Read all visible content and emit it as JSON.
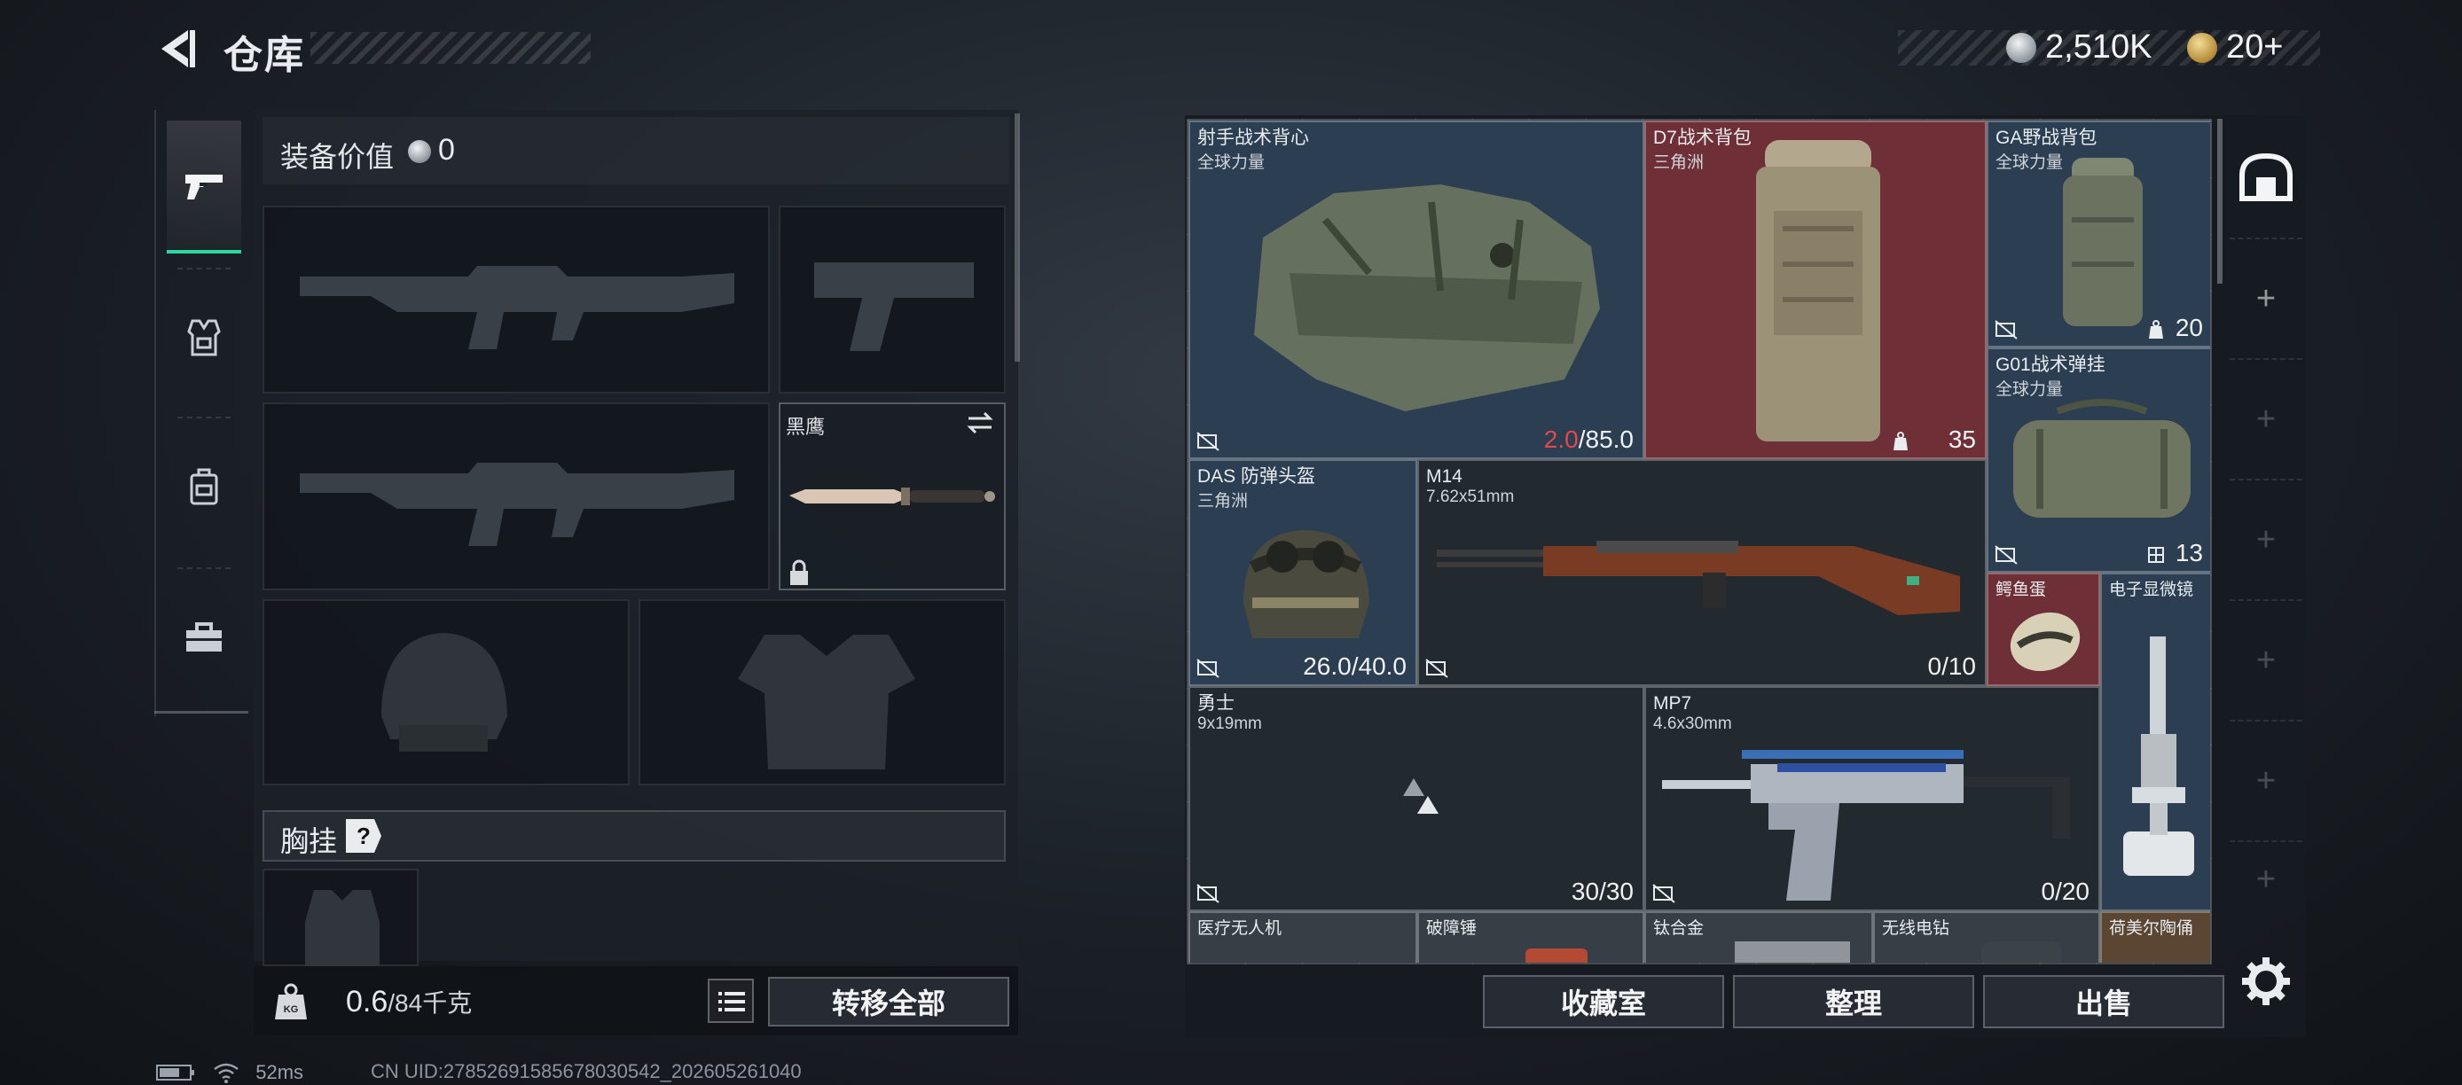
{
  "header": {
    "title": "仓库",
    "currency_main": "2,510K",
    "currency_secondary": "20+"
  },
  "side_tabs": [
    {
      "name": "weapons-tab",
      "icon": "pistol-icon",
      "active": true
    },
    {
      "name": "armor-tab",
      "icon": "armor-vest-icon",
      "active": false
    },
    {
      "name": "backpack-tab",
      "icon": "backpack-icon",
      "active": false
    },
    {
      "name": "toolbox-tab",
      "icon": "toolbox-icon",
      "active": false
    }
  ],
  "equipment": {
    "value_label": "装备价值",
    "value": "0",
    "knife_name": "黑鹰",
    "chest_rig_label": "胸挂",
    "help": "?",
    "weight_value": "0.6",
    "weight_capacity": "/84千克",
    "transfer_all": "转移全部"
  },
  "stash": {
    "items": [
      {
        "name": "射手战术背心",
        "sub": "全球力量",
        "value_hl": "2.0",
        "value": "/85.0"
      },
      {
        "name": "D7战术背包",
        "sub": "三角洲",
        "value": "35"
      },
      {
        "name": "GA野战背包",
        "sub": "全球力量",
        "value": "20"
      },
      {
        "name": "G01战术弹挂",
        "sub": "全球力量",
        "value": "13"
      },
      {
        "name": "DAS 防弹头盔",
        "sub": "三角洲",
        "value": "26.0/40.0"
      },
      {
        "name": "M14",
        "sub": "7.62x51mm",
        "value": "0/10"
      },
      {
        "name": "鳄鱼蛋",
        "sub": "",
        "value": ""
      },
      {
        "name": "电子显微镜",
        "sub": "",
        "value": ""
      },
      {
        "name": "勇士",
        "sub": "9x19mm",
        "value": "30/30"
      },
      {
        "name": "MP7",
        "sub": "4.6x30mm",
        "value": "0/20"
      },
      {
        "name": "医疗无人机",
        "sub": "",
        "value": ""
      },
      {
        "name": "破障锤",
        "sub": "",
        "value": ""
      },
      {
        "name": "钛合金",
        "sub": "",
        "value": ""
      },
      {
        "name": "无线电钻",
        "sub": "",
        "value": ""
      },
      {
        "name": "荷美尔陶俑",
        "sub": "",
        "value": ""
      }
    ],
    "buttons": {
      "collection": "收藏室",
      "sort": "整理",
      "sell": "出售"
    },
    "plus": "+"
  },
  "status": {
    "ping": "52ms",
    "uid": "CN UID:2785269158567803054​2_202605261040"
  },
  "colors": {
    "accent_green": "#2fd6a0",
    "rarity_blue": "#2b3e52",
    "rarity_red": "#6f2f37",
    "rarity_gold": "#5a4632",
    "warning_red": "#e14a4a"
  }
}
